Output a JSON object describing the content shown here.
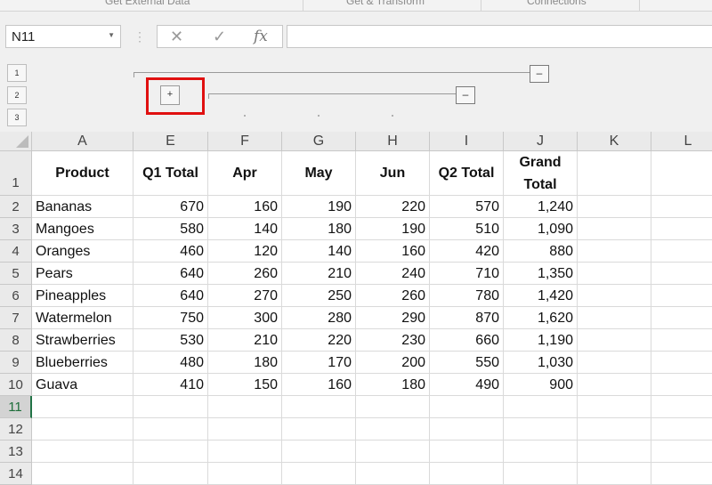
{
  "ribbon": {
    "groups": [
      "Get External Data",
      "Get & Transform",
      "Connections"
    ]
  },
  "formula_bar": {
    "name_box_value": "N11",
    "cancel_icon": "x-icon",
    "enter_icon": "check-icon",
    "function_label": "fx",
    "formula_value": ""
  },
  "outline": {
    "levels": [
      "1",
      "2",
      "3"
    ],
    "collapse_symbol": "–",
    "expand_symbol": "+"
  },
  "sheet": {
    "columns": [
      "A",
      "E",
      "F",
      "G",
      "H",
      "I",
      "J",
      "K",
      "L"
    ],
    "rows": [
      "1",
      "2",
      "3",
      "4",
      "5",
      "6",
      "7",
      "8",
      "9",
      "10",
      "11",
      "12",
      "13",
      "14"
    ],
    "headers": [
      "Product",
      "Q1 Total",
      "Apr",
      "May",
      "Jun",
      "Q2 Total",
      "Grand",
      "Total"
    ],
    "data": [
      [
        "Bananas",
        "670",
        "160",
        "190",
        "220",
        "570",
        "1,240"
      ],
      [
        "Mangoes",
        "580",
        "140",
        "180",
        "190",
        "510",
        "1,090"
      ],
      [
        "Oranges",
        "460",
        "120",
        "140",
        "160",
        "420",
        "880"
      ],
      [
        "Pears",
        "640",
        "260",
        "210",
        "240",
        "710",
        "1,350"
      ],
      [
        "Pineapples",
        "640",
        "270",
        "250",
        "260",
        "780",
        "1,420"
      ],
      [
        "Watermelon",
        "750",
        "300",
        "280",
        "290",
        "870",
        "1,620"
      ],
      [
        "Strawberries",
        "530",
        "210",
        "220",
        "230",
        "660",
        "1,190"
      ],
      [
        "Blueberries",
        "480",
        "180",
        "170",
        "200",
        "550",
        "1,030"
      ],
      [
        "Guava",
        "410",
        "150",
        "160",
        "180",
        "490",
        "900"
      ]
    ],
    "selected_row": "11",
    "accent_color": "#217346",
    "highlight_color": "#e01010"
  }
}
